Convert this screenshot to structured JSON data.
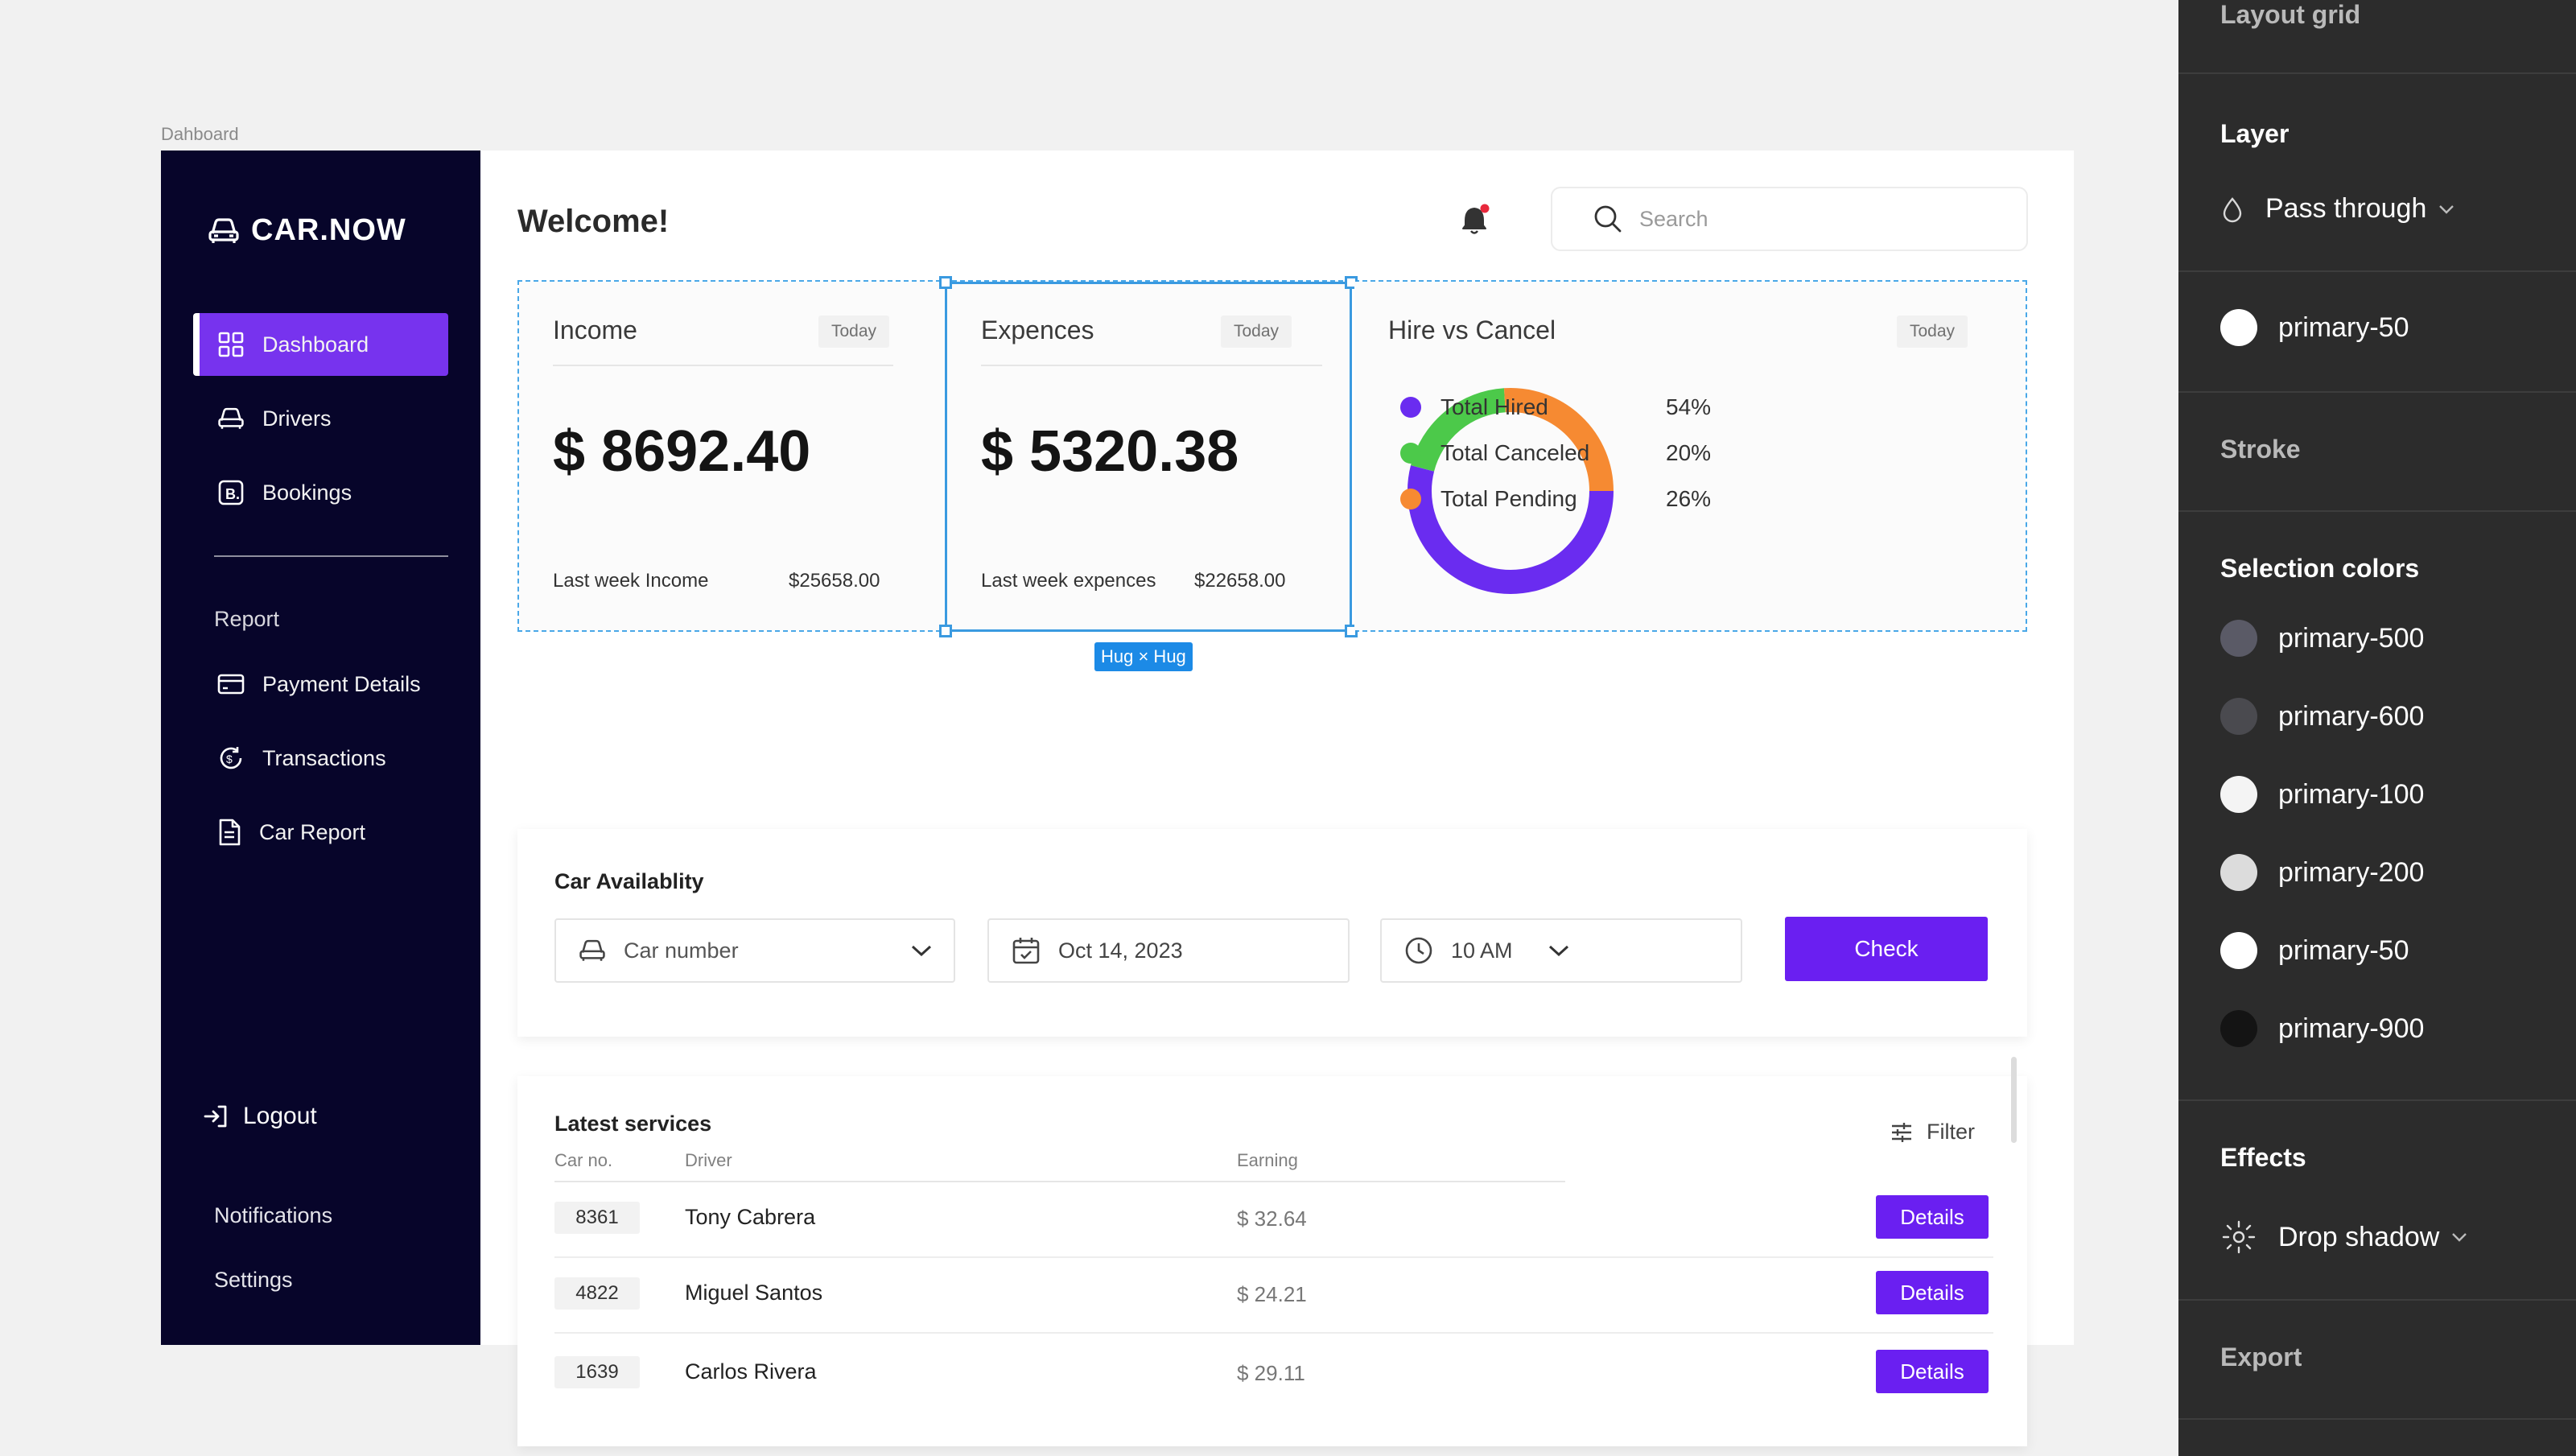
{
  "frame_label": "Dahboard",
  "sidebar": {
    "brand": "CAR.NOW",
    "items": [
      {
        "label": "Dashboard",
        "icon": "dashboard-grid-icon",
        "active": true
      },
      {
        "label": "Drivers",
        "icon": "car-icon"
      },
      {
        "label": "Bookings",
        "icon": "bookings-b-icon"
      }
    ],
    "report_label": "Report",
    "report_items": [
      {
        "label": "Payment Details",
        "icon": "card-icon"
      },
      {
        "label": "Transactions",
        "icon": "transactions-icon"
      },
      {
        "label": "Car Report",
        "icon": "document-icon"
      }
    ],
    "logout": "Logout",
    "notifications": "Notifications",
    "settings": "Settings"
  },
  "header": {
    "welcome": "Welcome!",
    "search_placeholder": "Search"
  },
  "cards": {
    "income": {
      "title": "Income",
      "badge": "Today",
      "amount": "$ 8692.40",
      "foot_label": "Last week Income",
      "foot_value": "$25658.00"
    },
    "expenses": {
      "title": "Expences",
      "badge": "Today",
      "amount": "$ 5320.38",
      "foot_label": "Last week expences",
      "foot_value": "$22658.00"
    },
    "hire": {
      "title": "Hire vs Cancel",
      "badge": "Today",
      "legend": [
        {
          "label": "Total Hired",
          "value": "54%",
          "percent": 54,
          "color": "#6a2cf0"
        },
        {
          "label": "Total Canceled",
          "value": "20%",
          "percent": 20,
          "color": "#4cc94a"
        },
        {
          "label": "Total Pending",
          "value": "26%",
          "percent": 26,
          "color": "#f68a32"
        }
      ]
    },
    "selection_badge": "Hug × Hug"
  },
  "availability": {
    "title": "Car Availablity",
    "car_placeholder": "Car number",
    "date": "Oct 14, 2023",
    "time": "10 AM",
    "check": "Check"
  },
  "services": {
    "title": "Latest services",
    "filter": "Filter",
    "columns": [
      "Car no.",
      "Driver",
      "Earning"
    ],
    "rows": [
      {
        "car": "8361",
        "driver": "Tony Cabrera",
        "earning": "$ 32.64",
        "action": "Details"
      },
      {
        "car": "4822",
        "driver": "Miguel Santos",
        "earning": "$ 24.21",
        "action": "Details"
      },
      {
        "car": "1639",
        "driver": "Carlos Rivera",
        "earning": "$ 29.11",
        "action": "Details"
      }
    ]
  },
  "right_panel": {
    "layout_grid": "Layout grid",
    "layer": "Layer",
    "blend": "Pass through",
    "fill": {
      "name": "primary-50",
      "color": "#ffffff"
    },
    "stroke": "Stroke",
    "selection_colors": "Selection colors",
    "colors": [
      {
        "name": "primary-500",
        "color": "#5a5a66"
      },
      {
        "name": "primary-600",
        "color": "#4a4a4f"
      },
      {
        "name": "primary-100",
        "color": "#f4f4f4"
      },
      {
        "name": "primary-200",
        "color": "#dcdcdc"
      },
      {
        "name": "primary-50",
        "color": "#ffffff"
      },
      {
        "name": "primary-900",
        "color": "#141414"
      }
    ],
    "effects": "Effects",
    "effect": "Drop shadow",
    "export": "Export"
  }
}
